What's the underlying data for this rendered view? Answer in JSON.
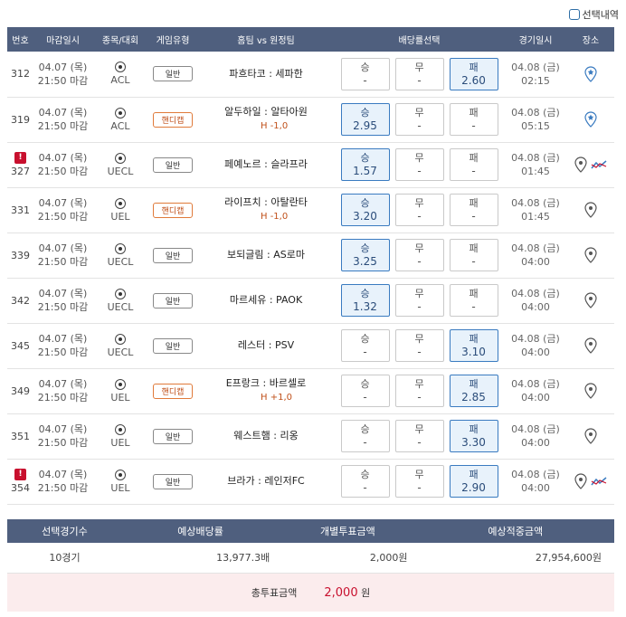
{
  "select_history_label": "선택내역",
  "headers": {
    "no": "번호",
    "deadline": "마감일시",
    "league": "종목/대회",
    "type": "게임유형",
    "match": "홈팀 vs 원정팀",
    "odds": "배당률선택",
    "time": "경기일시",
    "venue": "장소"
  },
  "rows": [
    {
      "no": "312",
      "warn": false,
      "date": "04.07 (목)",
      "close": "21:50 마감",
      "league": "ACL",
      "type": "일반",
      "hc": false,
      "home": "파흐타코",
      "away": "세파한",
      "handicap": "",
      "win": "-",
      "draw": "-",
      "lose": "2.60",
      "sel": "lose",
      "mdate": "04.08 (금)",
      "mtime": "02:15",
      "venue": "star"
    },
    {
      "no": "319",
      "warn": false,
      "date": "04.07 (목)",
      "close": "21:50 마감",
      "league": "ACL",
      "type": "핸디캡",
      "hc": true,
      "home": "알두하일",
      "away": "알타아원",
      "handicap": "H -1,0",
      "win": "2.95",
      "draw": "-",
      "lose": "-",
      "sel": "win",
      "mdate": "04.08 (금)",
      "mtime": "05:15",
      "venue": "star"
    },
    {
      "no": "327",
      "warn": true,
      "date": "04.07 (목)",
      "close": "21:50 마감",
      "league": "UECL",
      "type": "일반",
      "hc": false,
      "home": "페예노르",
      "away": "슬라프라",
      "handicap": "",
      "win": "1.57",
      "draw": "-",
      "lose": "-",
      "sel": "win",
      "mdate": "04.08 (금)",
      "mtime": "01:45",
      "venue": "pin-chart"
    },
    {
      "no": "331",
      "warn": false,
      "date": "04.07 (목)",
      "close": "21:50 마감",
      "league": "UEL",
      "type": "핸디캡",
      "hc": true,
      "home": "라이프치",
      "away": "아탈란타",
      "handicap": "H -1,0",
      "win": "3.20",
      "draw": "-",
      "lose": "-",
      "sel": "win",
      "mdate": "04.08 (금)",
      "mtime": "01:45",
      "venue": "pin"
    },
    {
      "no": "339",
      "warn": false,
      "date": "04.07 (목)",
      "close": "21:50 마감",
      "league": "UECL",
      "type": "일반",
      "hc": false,
      "home": "보되글림",
      "away": "AS로마",
      "handicap": "",
      "win": "3.25",
      "draw": "-",
      "lose": "-",
      "sel": "win",
      "mdate": "04.08 (금)",
      "mtime": "04:00",
      "venue": "pin"
    },
    {
      "no": "342",
      "warn": false,
      "date": "04.07 (목)",
      "close": "21:50 마감",
      "league": "UECL",
      "type": "일반",
      "hc": false,
      "home": "마르세유",
      "away": "PAOK",
      "handicap": "",
      "win": "1.32",
      "draw": "-",
      "lose": "-",
      "sel": "win",
      "mdate": "04.08 (금)",
      "mtime": "04:00",
      "venue": "pin"
    },
    {
      "no": "345",
      "warn": false,
      "date": "04.07 (목)",
      "close": "21:50 마감",
      "league": "UECL",
      "type": "일반",
      "hc": false,
      "home": "레스터",
      "away": "PSV",
      "handicap": "",
      "win": "-",
      "draw": "-",
      "lose": "3.10",
      "sel": "lose",
      "mdate": "04.08 (금)",
      "mtime": "04:00",
      "venue": "pin"
    },
    {
      "no": "349",
      "warn": false,
      "date": "04.07 (목)",
      "close": "21:50 마감",
      "league": "UEL",
      "type": "핸디캡",
      "hc": true,
      "home": "E프랑크",
      "away": "바르셀로",
      "handicap": "H +1,0",
      "win": "-",
      "draw": "-",
      "lose": "2.85",
      "sel": "lose",
      "mdate": "04.08 (금)",
      "mtime": "04:00",
      "venue": "pin"
    },
    {
      "no": "351",
      "warn": false,
      "date": "04.07 (목)",
      "close": "21:50 마감",
      "league": "UEL",
      "type": "일반",
      "hc": false,
      "home": "웨스트햄",
      "away": "리옹",
      "handicap": "",
      "win": "-",
      "draw": "-",
      "lose": "3.30",
      "sel": "lose",
      "mdate": "04.08 (금)",
      "mtime": "04:00",
      "venue": "pin"
    },
    {
      "no": "354",
      "warn": true,
      "date": "04.07 (목)",
      "close": "21:50 마감",
      "league": "UEL",
      "type": "일반",
      "hc": false,
      "home": "브라가",
      "away": "레인저FC",
      "handicap": "",
      "win": "-",
      "draw": "-",
      "lose": "2.90",
      "sel": "lose",
      "mdate": "04.08 (금)",
      "mtime": "04:00",
      "venue": "pin-chart"
    }
  ],
  "labels": {
    "win": "승",
    "draw": "무",
    "lose": "패",
    "vs": ":"
  },
  "summary": {
    "h1": "선택경기수",
    "h2": "예상배당률",
    "h3": "개별투표금액",
    "h4": "예상적중금액",
    "v1": "10경기",
    "v2": "13,977.3배",
    "v3": "2,000원",
    "v4": "27,954,600원"
  },
  "total": {
    "label": "총투표금액",
    "amount": "2,000",
    "unit": "원"
  },
  "colors": {
    "header": "#4f5f7e",
    "selected": "#e8f2fb",
    "accent": "#c8102e"
  }
}
